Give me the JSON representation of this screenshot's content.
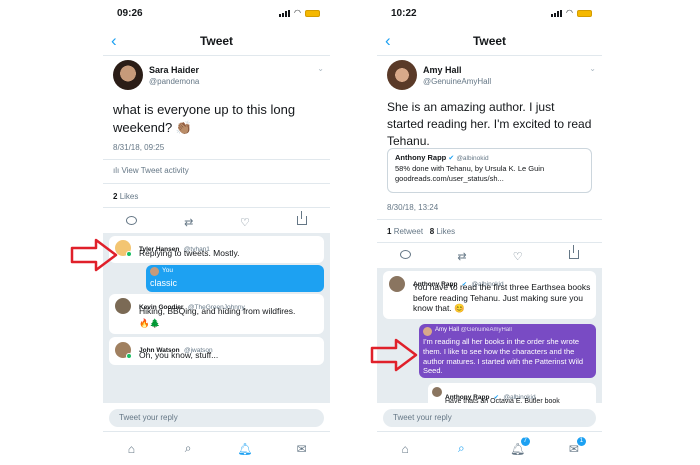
{
  "left": {
    "status_time": "09:26",
    "nav_title": "Tweet",
    "author_name": "Sara Haider",
    "author_handle": "@pandemona",
    "tweet_text": "what is everyone up to this long weekend? 👏🏽",
    "timestamp": "8/31/18, 09:25",
    "activity_link": "View Tweet activity",
    "likes_count": "2",
    "likes_label": "Likes",
    "replies": [
      {
        "name": "Tyler Hansen",
        "handle": "@tyhan1",
        "text": "Replying to tweets. Mostly."
      },
      {
        "name": "You",
        "text": "classic"
      },
      {
        "name": "Kevin Goodier",
        "handle": "@TheGreenJohnny",
        "text": "Hiking, BBQing, and hiding from wildfires.",
        "emoji": "🔥🌲"
      },
      {
        "name": "John Watson",
        "handle": "@jwatson",
        "text": "Oh, you know, stuff..."
      }
    ],
    "reply_placeholder": "Tweet your reply"
  },
  "right": {
    "status_time": "10:22",
    "nav_title": "Tweet",
    "author_name": "Amy Hall",
    "author_handle": "@GenuineAmyHall",
    "tweet_text": "She is an amazing author. I just started reading her. I'm excited to read Tehanu.",
    "quote_name": "Anthony Rapp",
    "quote_handle": "@albinokid",
    "quote_text": "58% done with Tehanu, by Ursula K. Le Guin goodreads.com/user_status/sh...",
    "timestamp": "8/30/18, 13:24",
    "retweet_count": "1",
    "retweet_label": "Retweet",
    "likes_count": "8",
    "likes_label": "Likes",
    "replies": [
      {
        "name": "Anthony Rapp",
        "handle": "@albinokid",
        "text": "You have to read the first three Earthsea books before reading Tehanu. Just making sure you know that. 😊"
      },
      {
        "name": "Amy Hall",
        "handle": "@GenuineAmyHall",
        "text": "I'm reading all her books in the order she wrote them. I like to see how the characters and the author matures. I started with the Patterinst Wild Seed."
      },
      {
        "name": "Anthony Rapp",
        "handle": "@albinokid",
        "text": "Have thats an Octavia E. Butler book"
      }
    ],
    "reply_placeholder": "Tweet your reply",
    "badge_notifications": "7",
    "badge_messages": "1"
  },
  "colors": {
    "accent": "#1da1f2",
    "purple": "#794bc4",
    "arrow": "#e0202a",
    "online": "#17bf63"
  }
}
